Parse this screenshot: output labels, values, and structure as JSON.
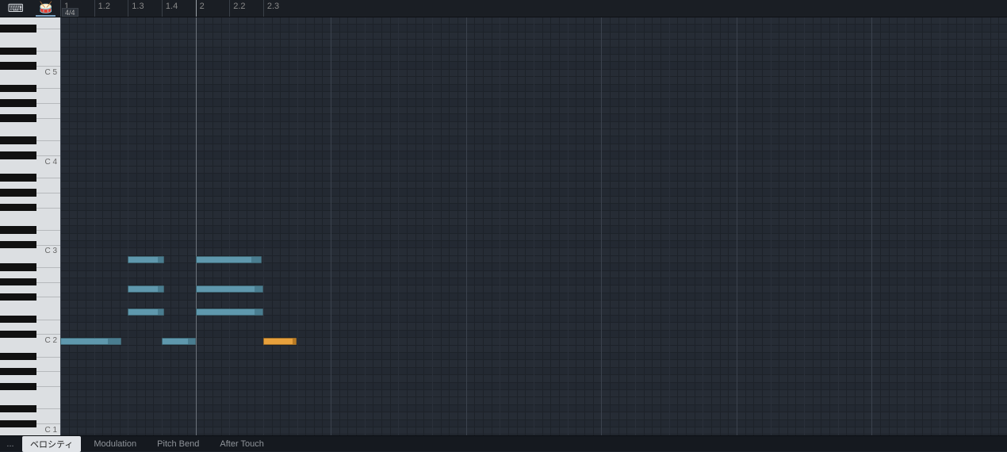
{
  "layout": {
    "pianoWidth": 76,
    "rulerHeight": 22,
    "bottomHeight": 20,
    "gridWidthPx": 1194,
    "gridHeightPx": 527,
    "semitoneHeight": 9.4,
    "highestMidiTop": 79,
    "lowestOctaveLabel": 1,
    "beatsVisible": 7.0,
    "startBeat": 1.0,
    "playheadBeat": 2.0
  },
  "tools": [
    {
      "name": "keyboard-icon",
      "glyph": "⌨",
      "active": false
    },
    {
      "name": "drum-icon",
      "glyph": "🥁",
      "active": true
    }
  ],
  "timeSignature": "4/4",
  "rulerTicks": [
    {
      "label": "1",
      "beat": 1.0
    },
    {
      "label": "1.2",
      "beat": 1.25
    },
    {
      "label": "1.3",
      "beat": 1.5
    },
    {
      "label": "1.4",
      "beat": 1.75
    },
    {
      "label": "2",
      "beat": 2.0
    },
    {
      "label": "2.2",
      "beat": 2.25
    },
    {
      "label": "2.3",
      "beat": 2.5
    }
  ],
  "octaveLabels": [
    {
      "text": "C 5",
      "midi": 72
    },
    {
      "text": "C 4",
      "midi": 60
    },
    {
      "text": "C 3",
      "midi": 48
    },
    {
      "text": "C 2",
      "midi": 36
    },
    {
      "text": "C 1",
      "midi": 24
    }
  ],
  "gridSubdivisions": 4,
  "notes": [
    {
      "midi": 36,
      "startBeat": 1.0,
      "lenBeats": 0.45,
      "color": "blue",
      "tailFrac": 0.2
    },
    {
      "midi": 47,
      "startBeat": 1.5,
      "lenBeats": 0.27,
      "color": "blue",
      "tailFrac": 0.15
    },
    {
      "midi": 43,
      "startBeat": 1.5,
      "lenBeats": 0.27,
      "color": "blue",
      "tailFrac": 0.15
    },
    {
      "midi": 40,
      "startBeat": 1.5,
      "lenBeats": 0.27,
      "color": "blue",
      "tailFrac": 0.15
    },
    {
      "midi": 36,
      "startBeat": 1.75,
      "lenBeats": 0.25,
      "color": "blue",
      "tailFrac": 0.2
    },
    {
      "midi": 47,
      "startBeat": 2.0,
      "lenBeats": 0.49,
      "color": "blue",
      "tailFrac": 0.15
    },
    {
      "midi": 43,
      "startBeat": 2.0,
      "lenBeats": 0.5,
      "color": "blue",
      "tailFrac": 0.12
    },
    {
      "midi": 40,
      "startBeat": 2.0,
      "lenBeats": 0.5,
      "color": "blue",
      "tailFrac": 0.12
    },
    {
      "midi": 36,
      "startBeat": 2.5,
      "lenBeats": 0.25,
      "color": "orange",
      "tailFrac": 0.1
    }
  ],
  "bottomTabs": {
    "more": "...",
    "items": [
      {
        "label": "ベロシティ",
        "selected": true
      },
      {
        "label": "Modulation",
        "selected": false
      },
      {
        "label": "Pitch Bend",
        "selected": false
      },
      {
        "label": "After Touch",
        "selected": false
      }
    ]
  }
}
